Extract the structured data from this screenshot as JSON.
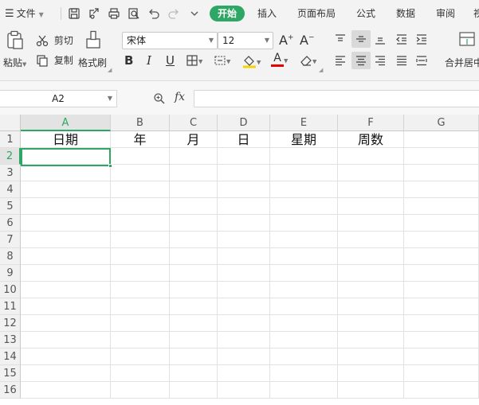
{
  "menu": {
    "file_label": "文件",
    "tabs": [
      "开始",
      "插入",
      "页面布局",
      "公式",
      "数据",
      "审阅",
      "视"
    ],
    "active_tab": "开始",
    "accent_color": "#2ea764"
  },
  "ribbon": {
    "paste_label": "粘贴",
    "cut_label": "剪切",
    "copy_label": "复制",
    "format_painter_label": "格式刷",
    "font_name": "宋体",
    "font_size": "12",
    "bold": "B",
    "italic": "I",
    "underline": "U",
    "merge_center_label": "合并居中",
    "grow_font": "A",
    "shrink_font": "A",
    "font_color_letter": "A"
  },
  "formula_bar": {
    "name_box": "A2",
    "fx_label": "fx",
    "formula_value": ""
  },
  "sheet": {
    "columns": [
      "A",
      "B",
      "C",
      "D",
      "E",
      "F",
      "G"
    ],
    "rows": [
      "1",
      "2",
      "3",
      "4",
      "5",
      "6",
      "7",
      "8",
      "9",
      "10",
      "11",
      "12",
      "13",
      "14",
      "15",
      "16"
    ],
    "active_cell": "A2",
    "row1": [
      "日期",
      "年",
      "月",
      "日",
      "星期",
      "周数",
      ""
    ]
  }
}
